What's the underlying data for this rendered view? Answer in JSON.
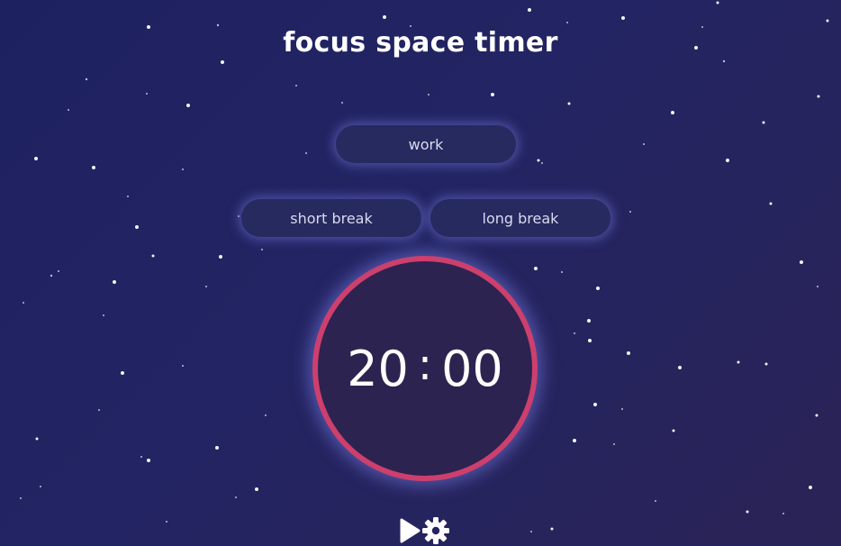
{
  "app": {
    "title": "focus space timer"
  },
  "modes": {
    "work": "work",
    "short_break": "short break",
    "long_break": "long break"
  },
  "timer": {
    "minutes": "20",
    "separator": ":",
    "seconds": "00"
  },
  "controls": {
    "play_icon": "play-icon",
    "settings_icon": "gear-icon"
  },
  "colors": {
    "background_start": "#1e2160",
    "background_end": "#2a2356",
    "ring": "#cd3f6d",
    "pill": "#262a5f",
    "glow": "#7378dc"
  }
}
